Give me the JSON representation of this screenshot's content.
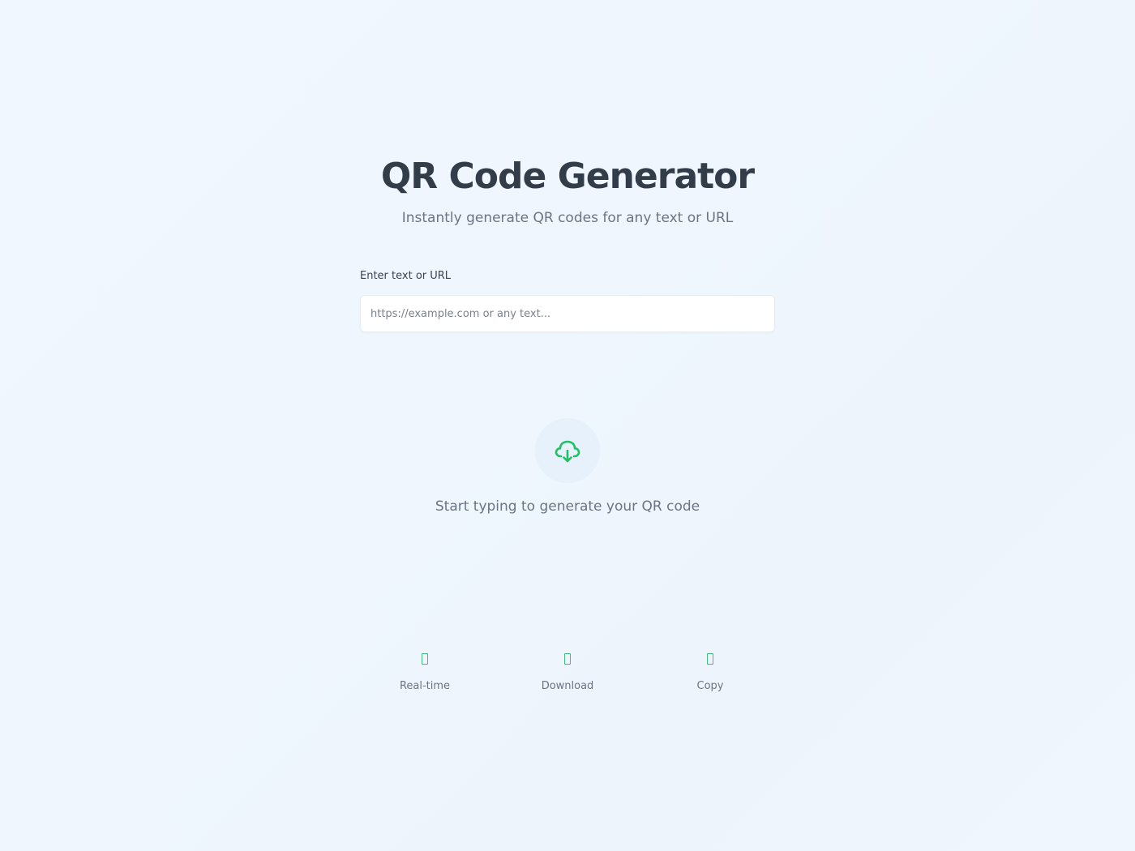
{
  "header": {
    "title": "QR Code Generator",
    "subtitle": "Instantly generate QR codes for any text or URL"
  },
  "form": {
    "label": "Enter text or URL",
    "placeholder": "https://example.com or any text...",
    "value": ""
  },
  "empty_state": {
    "icon": "cloud-download-icon",
    "message": "Start typing to generate your QR code"
  },
  "features": [
    {
      "icon": "bolt-icon",
      "label": "Real-time"
    },
    {
      "icon": "download-icon",
      "label": "Download"
    },
    {
      "icon": "copy-icon",
      "label": "Copy"
    }
  ],
  "colors": {
    "accent": "#22c063",
    "background": "#eff6fe",
    "heading": "#333d49",
    "muted": "#6b7481"
  }
}
